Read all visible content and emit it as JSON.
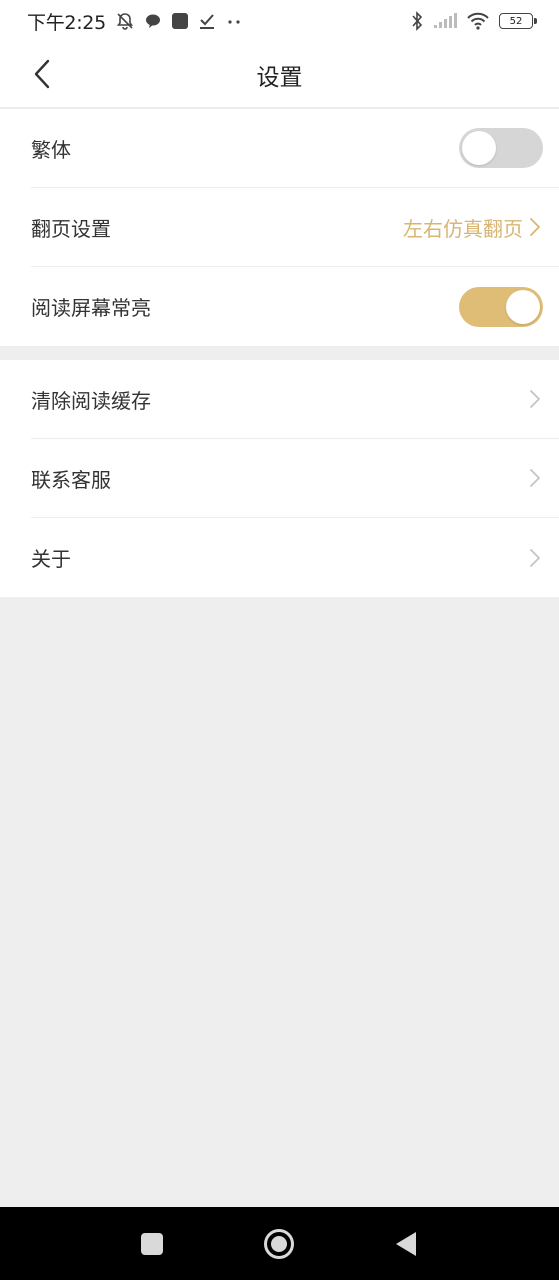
{
  "status_bar": {
    "time": "下午2:25",
    "battery": "52",
    "icons_left": [
      "bell-muted-icon",
      "chat-bubble-icon",
      "app-square-icon",
      "check-icon",
      "more-dots-icon"
    ],
    "icons_right": [
      "bluetooth-icon",
      "signal-icon",
      "wifi-icon",
      "battery-icon"
    ]
  },
  "header": {
    "title": "设置",
    "back_icon": "chevron-left-icon"
  },
  "groups": [
    {
      "items": [
        {
          "label": "繁体",
          "type": "toggle",
          "on": false
        },
        {
          "label": "翻页设置",
          "type": "link",
          "value": "左右仿真翻页"
        },
        {
          "label": "阅读屏幕常亮",
          "type": "toggle",
          "on": true
        }
      ]
    },
    {
      "items": [
        {
          "label": "清除阅读缓存",
          "type": "link"
        },
        {
          "label": "联系客服",
          "type": "link"
        },
        {
          "label": "关于",
          "type": "link"
        }
      ]
    }
  ],
  "colors": {
    "accent": "#dfbd76",
    "accent_text": "#d8b573",
    "toggle_off": "#d6d6d6",
    "background": "#eeeeee"
  },
  "nav_bar": {
    "icons": [
      "recent-apps-icon",
      "home-icon",
      "back-triangle-icon"
    ]
  }
}
